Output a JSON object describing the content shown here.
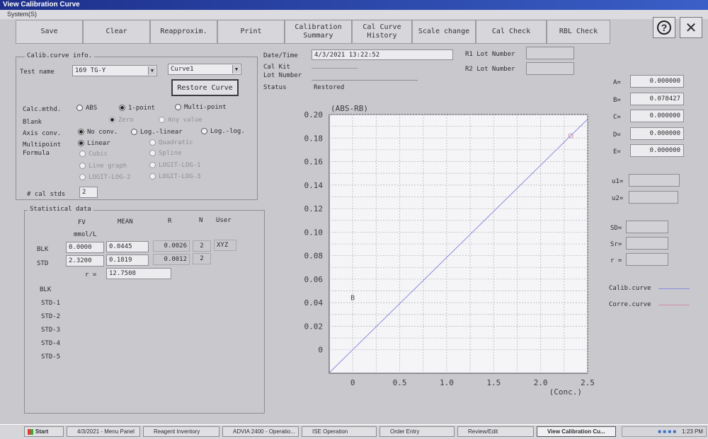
{
  "window": {
    "title": "View Calibration Curve",
    "menu": "System(S)"
  },
  "toolbar": [
    {
      "label": "Save",
      "w": 95
    },
    {
      "label": "Clear",
      "w": 95
    },
    {
      "label": "Reapproxim.",
      "w": 95
    },
    {
      "label": "Print",
      "w": 95
    },
    {
      "label": "Calibration\nSummary",
      "w": 95
    },
    {
      "label": "Cal Curve\nHistory",
      "w": 85
    },
    {
      "label": "Scale change",
      "w": 90
    },
    {
      "label": "Cal Check",
      "w": 100
    },
    {
      "label": "RBL Check",
      "w": 90
    }
  ],
  "header_info": {
    "date_time_label": "Date/Time",
    "date_time_value": "4/3/2021 13:22:52",
    "cal_kit_label": "Cal Kit",
    "lot_number_label": "Lot Number",
    "status_label": "Status",
    "status_value": "Restored",
    "r1_lot_label": "R1 Lot Number",
    "r2_lot_label": "R2 Lot Number"
  },
  "calib_info": {
    "legend": "Calib.curve info.",
    "test_name_label": "Test name",
    "test_name_value": "169 TG-Y",
    "curve_value": "Curve1",
    "restore_button": "Restore Curve",
    "calc_label": "Calc.mthd.",
    "calc_abs": "ABS",
    "calc_1point": "1-point",
    "calc_multipoint": "Multi-point",
    "blank_label": "Blank",
    "blank_zero": "Zero",
    "blank_any": "Any value",
    "axis_label": "Axis conv.",
    "axis_no": "No conv.",
    "axis_loglinear": "Log.-linear",
    "axis_loglog": "Log.-log.",
    "multipoint_label": "Multipoint",
    "formula_label": "Formula",
    "f_linear": "Linear",
    "f_quadratic": "Quadratic",
    "f_cubic": "Cubic",
    "f_spline": "Spline",
    "f_linegraph": "Line graph",
    "f_logit1": "LOGIT-LOG-1",
    "f_logit2": "LOGIT-LOG-2",
    "f_logit3": "LOGIT-LOG-3",
    "cal_stds_label": "# cal stds",
    "cal_stds_value": "2"
  },
  "stats": {
    "legend": "Statistical data",
    "col_fv": "FV",
    "col_mean": "MEAN",
    "col_r": "R",
    "col_n": "N",
    "col_user": "User",
    "unit": "mmol/L",
    "blk_label": "BLK",
    "blk_fv": "0.0000",
    "blk_mean": "0.0445",
    "blk_r": "0.0026",
    "blk_n": "2",
    "blk_user": "XYZ",
    "std_label": "STD",
    "std_fv": "2.3200",
    "std_mean": "0.1819",
    "std_r": "0.0012",
    "std_n": "2",
    "r_label": "r =",
    "r_value": "12.7508",
    "list": [
      "BLK",
      "STD-1",
      "STD-2",
      "STD-3",
      "STD-4",
      "STD-5"
    ]
  },
  "coefficients": [
    {
      "label": "A=",
      "value": "0.000000"
    },
    {
      "label": "B=",
      "value": "0.078427"
    },
    {
      "label": "C=",
      "value": "0.000000"
    },
    {
      "label": "D=",
      "value": "0.000000"
    },
    {
      "label": "E=",
      "value": "0.000000"
    }
  ],
  "right_fields": {
    "u1": "u1=",
    "u2": "u2=",
    "sd": "SD=",
    "sr": "Sr=",
    "r": "r ="
  },
  "legend_right": {
    "calib": "Calib.curve",
    "corre": "Corre.curve",
    "calib_color": "#8a8ae0",
    "corre_color": "#d08aa8"
  },
  "chart_data": {
    "type": "line",
    "ylabel": "(ABS-RB)",
    "xlabel": "(Conc.)",
    "xlim": [
      -0.25,
      2.5
    ],
    "ylim": [
      -0.02,
      0.2
    ],
    "x_ticks": [
      "0",
      "0.5",
      "1.0",
      "1.5",
      "2.0",
      "2.5"
    ],
    "x_tick_values": [
      0,
      0.5,
      1.0,
      1.5,
      2.0,
      2.5
    ],
    "y_ticks": [
      "0",
      "0.02",
      "0.04",
      "0.06",
      "0.08",
      "0.10",
      "0.12",
      "0.14",
      "0.16",
      "0.18",
      "0.20"
    ],
    "y_tick_values": [
      0,
      0.02,
      0.04,
      0.06,
      0.08,
      0.1,
      0.12,
      0.14,
      0.16,
      0.18,
      0.2
    ],
    "grid": true,
    "series": [
      {
        "name": "Calib.curve",
        "x": [
          -0.25,
          2.5
        ],
        "y": [
          -0.0196,
          0.1961
        ]
      }
    ],
    "points": [
      {
        "label": "B",
        "x": 0.0,
        "y": 0.0445
      },
      {
        "label": "",
        "x": 2.32,
        "y": 0.1819
      }
    ]
  },
  "taskbar": {
    "start": "Start",
    "items": [
      "4/3/2021 - Menu Panel",
      "Reagent Inventory",
      "ADVIA 2400 - Operatio...",
      "ISE Operation",
      "Order Entry",
      "Review/Edit",
      "View Calibration Cu..."
    ],
    "clock": "1:23 PM"
  }
}
